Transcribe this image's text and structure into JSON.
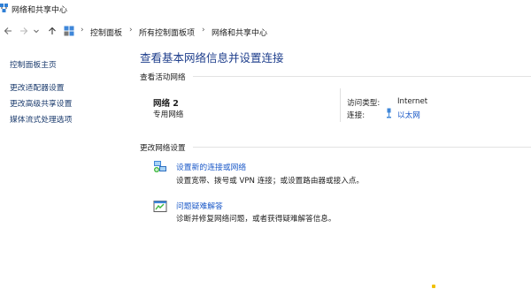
{
  "window": {
    "title": "网络和共享中心"
  },
  "breadcrumb": {
    "items": [
      "控制面板",
      "所有控制面板项",
      "网络和共享中心"
    ]
  },
  "sidebar": {
    "items": [
      {
        "label": "控制面板主页"
      },
      {
        "label": "更改适配器设置"
      },
      {
        "label": "更改高级共享设置"
      },
      {
        "label": "媒体流式处理选项"
      }
    ]
  },
  "main": {
    "title": "查看基本网络信息并设置连接",
    "active_section_label": "查看活动网络",
    "network": {
      "name": "网络 2",
      "type": "专用网络",
      "access_type_label": "访问类型:",
      "access_type_value": "Internet",
      "connection_label": "连接:",
      "connection_value": "以太网"
    },
    "change_section_label": "更改网络设置",
    "tasks": [
      {
        "icon": "new-connection-icon",
        "link": "设置新的连接或网络",
        "desc": "设置宽带、拨号或 VPN 连接；或设置路由器或接入点。"
      },
      {
        "icon": "troubleshoot-icon",
        "link": "问题疑难解答",
        "desc": "诊断并修复网络问题，或者获得疑难解答信息。"
      }
    ]
  },
  "colors": {
    "link": "#1c5ac8",
    "title": "#1e3e8c",
    "sidebar_link": "#1c3c6e"
  }
}
